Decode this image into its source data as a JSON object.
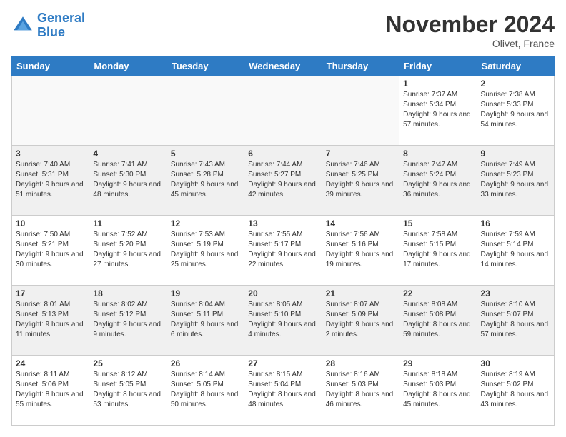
{
  "logo": {
    "line1": "General",
    "line2": "Blue"
  },
  "title": "November 2024",
  "location": "Olivet, France",
  "days_of_week": [
    "Sunday",
    "Monday",
    "Tuesday",
    "Wednesday",
    "Thursday",
    "Friday",
    "Saturday"
  ],
  "weeks": [
    [
      {
        "day": "",
        "info": ""
      },
      {
        "day": "",
        "info": ""
      },
      {
        "day": "",
        "info": ""
      },
      {
        "day": "",
        "info": ""
      },
      {
        "day": "",
        "info": ""
      },
      {
        "day": "1",
        "info": "Sunrise: 7:37 AM\nSunset: 5:34 PM\nDaylight: 9 hours and 57 minutes."
      },
      {
        "day": "2",
        "info": "Sunrise: 7:38 AM\nSunset: 5:33 PM\nDaylight: 9 hours and 54 minutes."
      }
    ],
    [
      {
        "day": "3",
        "info": "Sunrise: 7:40 AM\nSunset: 5:31 PM\nDaylight: 9 hours and 51 minutes."
      },
      {
        "day": "4",
        "info": "Sunrise: 7:41 AM\nSunset: 5:30 PM\nDaylight: 9 hours and 48 minutes."
      },
      {
        "day": "5",
        "info": "Sunrise: 7:43 AM\nSunset: 5:28 PM\nDaylight: 9 hours and 45 minutes."
      },
      {
        "day": "6",
        "info": "Sunrise: 7:44 AM\nSunset: 5:27 PM\nDaylight: 9 hours and 42 minutes."
      },
      {
        "day": "7",
        "info": "Sunrise: 7:46 AM\nSunset: 5:25 PM\nDaylight: 9 hours and 39 minutes."
      },
      {
        "day": "8",
        "info": "Sunrise: 7:47 AM\nSunset: 5:24 PM\nDaylight: 9 hours and 36 minutes."
      },
      {
        "day": "9",
        "info": "Sunrise: 7:49 AM\nSunset: 5:23 PM\nDaylight: 9 hours and 33 minutes."
      }
    ],
    [
      {
        "day": "10",
        "info": "Sunrise: 7:50 AM\nSunset: 5:21 PM\nDaylight: 9 hours and 30 minutes."
      },
      {
        "day": "11",
        "info": "Sunrise: 7:52 AM\nSunset: 5:20 PM\nDaylight: 9 hours and 27 minutes."
      },
      {
        "day": "12",
        "info": "Sunrise: 7:53 AM\nSunset: 5:19 PM\nDaylight: 9 hours and 25 minutes."
      },
      {
        "day": "13",
        "info": "Sunrise: 7:55 AM\nSunset: 5:17 PM\nDaylight: 9 hours and 22 minutes."
      },
      {
        "day": "14",
        "info": "Sunrise: 7:56 AM\nSunset: 5:16 PM\nDaylight: 9 hours and 19 minutes."
      },
      {
        "day": "15",
        "info": "Sunrise: 7:58 AM\nSunset: 5:15 PM\nDaylight: 9 hours and 17 minutes."
      },
      {
        "day": "16",
        "info": "Sunrise: 7:59 AM\nSunset: 5:14 PM\nDaylight: 9 hours and 14 minutes."
      }
    ],
    [
      {
        "day": "17",
        "info": "Sunrise: 8:01 AM\nSunset: 5:13 PM\nDaylight: 9 hours and 11 minutes."
      },
      {
        "day": "18",
        "info": "Sunrise: 8:02 AM\nSunset: 5:12 PM\nDaylight: 9 hours and 9 minutes."
      },
      {
        "day": "19",
        "info": "Sunrise: 8:04 AM\nSunset: 5:11 PM\nDaylight: 9 hours and 6 minutes."
      },
      {
        "day": "20",
        "info": "Sunrise: 8:05 AM\nSunset: 5:10 PM\nDaylight: 9 hours and 4 minutes."
      },
      {
        "day": "21",
        "info": "Sunrise: 8:07 AM\nSunset: 5:09 PM\nDaylight: 9 hours and 2 minutes."
      },
      {
        "day": "22",
        "info": "Sunrise: 8:08 AM\nSunset: 5:08 PM\nDaylight: 8 hours and 59 minutes."
      },
      {
        "day": "23",
        "info": "Sunrise: 8:10 AM\nSunset: 5:07 PM\nDaylight: 8 hours and 57 minutes."
      }
    ],
    [
      {
        "day": "24",
        "info": "Sunrise: 8:11 AM\nSunset: 5:06 PM\nDaylight: 8 hours and 55 minutes."
      },
      {
        "day": "25",
        "info": "Sunrise: 8:12 AM\nSunset: 5:05 PM\nDaylight: 8 hours and 53 minutes."
      },
      {
        "day": "26",
        "info": "Sunrise: 8:14 AM\nSunset: 5:05 PM\nDaylight: 8 hours and 50 minutes."
      },
      {
        "day": "27",
        "info": "Sunrise: 8:15 AM\nSunset: 5:04 PM\nDaylight: 8 hours and 48 minutes."
      },
      {
        "day": "28",
        "info": "Sunrise: 8:16 AM\nSunset: 5:03 PM\nDaylight: 8 hours and 46 minutes."
      },
      {
        "day": "29",
        "info": "Sunrise: 8:18 AM\nSunset: 5:03 PM\nDaylight: 8 hours and 45 minutes."
      },
      {
        "day": "30",
        "info": "Sunrise: 8:19 AM\nSunset: 5:02 PM\nDaylight: 8 hours and 43 minutes."
      }
    ]
  ]
}
